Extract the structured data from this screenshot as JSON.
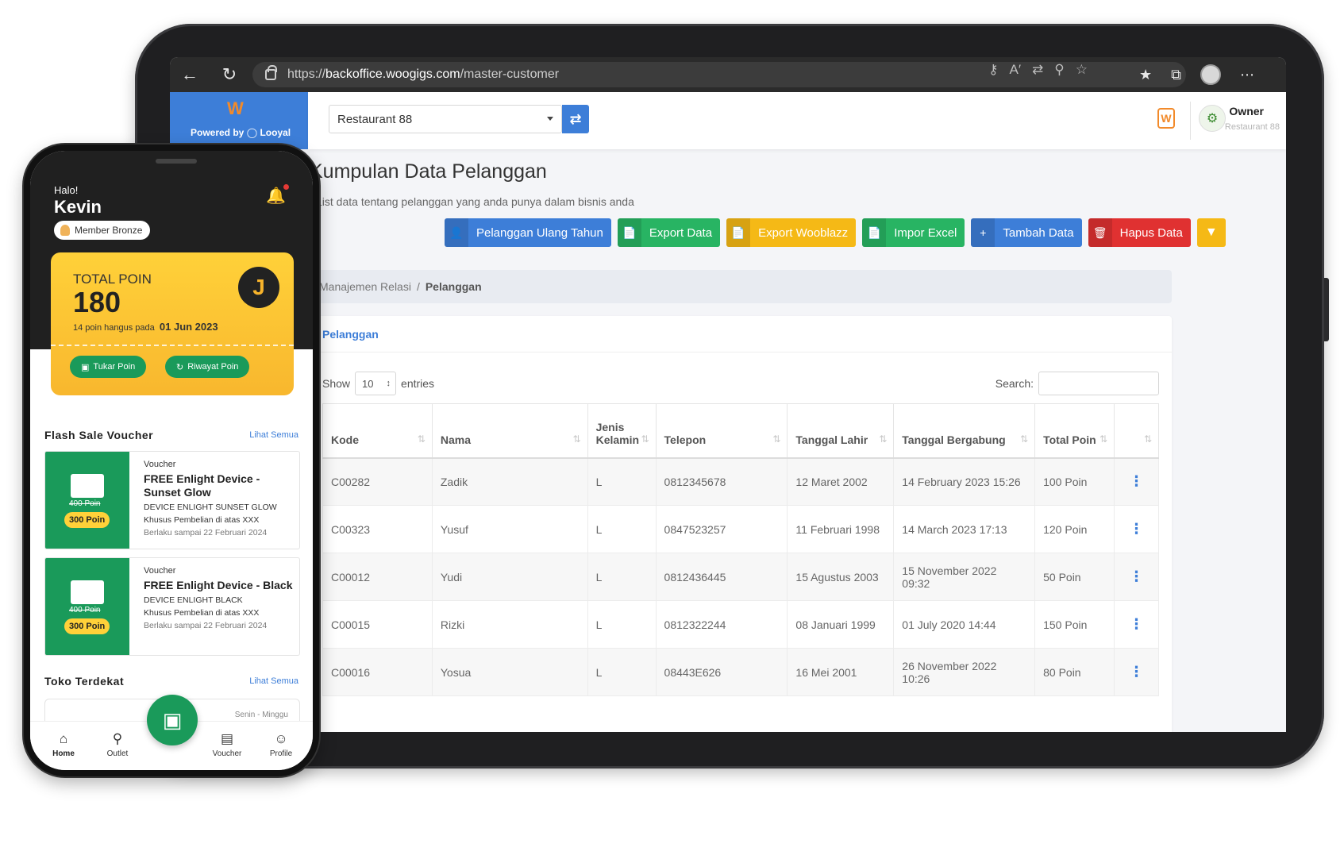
{
  "browser": {
    "url_prefix": "https://",
    "url_domain": "backoffice.woogigs.com",
    "url_path": "/master-customer"
  },
  "app": {
    "powered_by": "Powered by",
    "powered_brand": "Looyal",
    "outlet_selected": "Restaurant 88",
    "user_role": "Owner",
    "user_outlet": "Restaurant 88"
  },
  "page": {
    "title": "Kumpulan Data Pelanggan",
    "subtitle": "List data tentang pelanggan yang anda punya dalam bisnis anda"
  },
  "actions": [
    {
      "label": "Pelanggan Ulang Tahun",
      "color": "#3d7ed8"
    },
    {
      "label": "Export Data",
      "color": "#28b463"
    },
    {
      "label": "Export Wooblazz",
      "color": "#f5b916"
    },
    {
      "label": "Impor Excel",
      "color": "#28b463"
    },
    {
      "label": "Tambah Data",
      "color": "#3d7ed8"
    },
    {
      "label": "Hapus Data",
      "color": "#e03131"
    }
  ],
  "breadcrumb": {
    "parent": "Manajemen Relasi",
    "current": "Pelanggan"
  },
  "card": {
    "title": "Pelanggan",
    "show_label": "Show",
    "page_length": "10",
    "entries_label": "entries",
    "search_label": "Search:"
  },
  "table": {
    "headers": [
      "Kode",
      "Nama",
      "Jenis Kelamin",
      "Telepon",
      "Tanggal Lahir",
      "Tanggal Bergabung",
      "Total Poin",
      ""
    ],
    "rows": [
      [
        "C00282",
        "Zadik",
        "L",
        "0812345678",
        "12 Maret 2002",
        "14 February 2023 15:26",
        "100 Poin"
      ],
      [
        "C00323",
        "Yusuf",
        "L",
        "0847523257",
        "11 Februari 1998",
        "14 March 2023 17:13",
        "120 Poin"
      ],
      [
        "C00012",
        "Yudi",
        "L",
        "0812436445",
        "15 Agustus 2003",
        "15 November 2022 09:32",
        "50 Poin"
      ],
      [
        "C00015",
        "Rizki",
        "L",
        "0812322244",
        "08 Januari 1999",
        "01 July 2020 14:44",
        "150 Poin"
      ],
      [
        "C00016",
        "Yosua",
        "L",
        "08443E626",
        "16 Mei 2001",
        "26 November 2022 10:26",
        "80 Poin"
      ]
    ]
  },
  "phone": {
    "greeting": "Halo!",
    "name": "Kevin",
    "member": "Member Bronze",
    "total_poin_label": "TOTAL POIN",
    "total_poin": "180",
    "expire_text": "14 poin hangus pada",
    "expire_date": "01 Jun 2023",
    "tukar_btn": "Tukar Poin",
    "riwayat_btn": "Riwayat Poin",
    "flash_title": "Flash Sale Voucher",
    "see_all": "Lihat Semua",
    "vouchers": [
      {
        "type": "Voucher",
        "name": "FREE Enlight Device - Sunset Glow",
        "desc": "DEVICE ENLIGHT SUNSET GLOW",
        "min": "Khusus Pembelian di atas XXX",
        "until": "Berlaku sampai 22 Februari 2024",
        "old_price": "400 Poin",
        "price": "300 Poin"
      },
      {
        "type": "Voucher",
        "name": "FREE Enlight Device - Black",
        "desc": "DEVICE ENLIGHT BLACK",
        "min": "Khusus Pembelian di atas XXX",
        "until": "Berlaku sampai 22 Februari 2024",
        "old_price": "400 Poin",
        "price": "300 Poin"
      }
    ],
    "toko_title": "Toko Terdekat",
    "toko_days": "Senin - Minggu",
    "nav": [
      "Home",
      "Outlet",
      "Voucher",
      "Profile"
    ]
  }
}
